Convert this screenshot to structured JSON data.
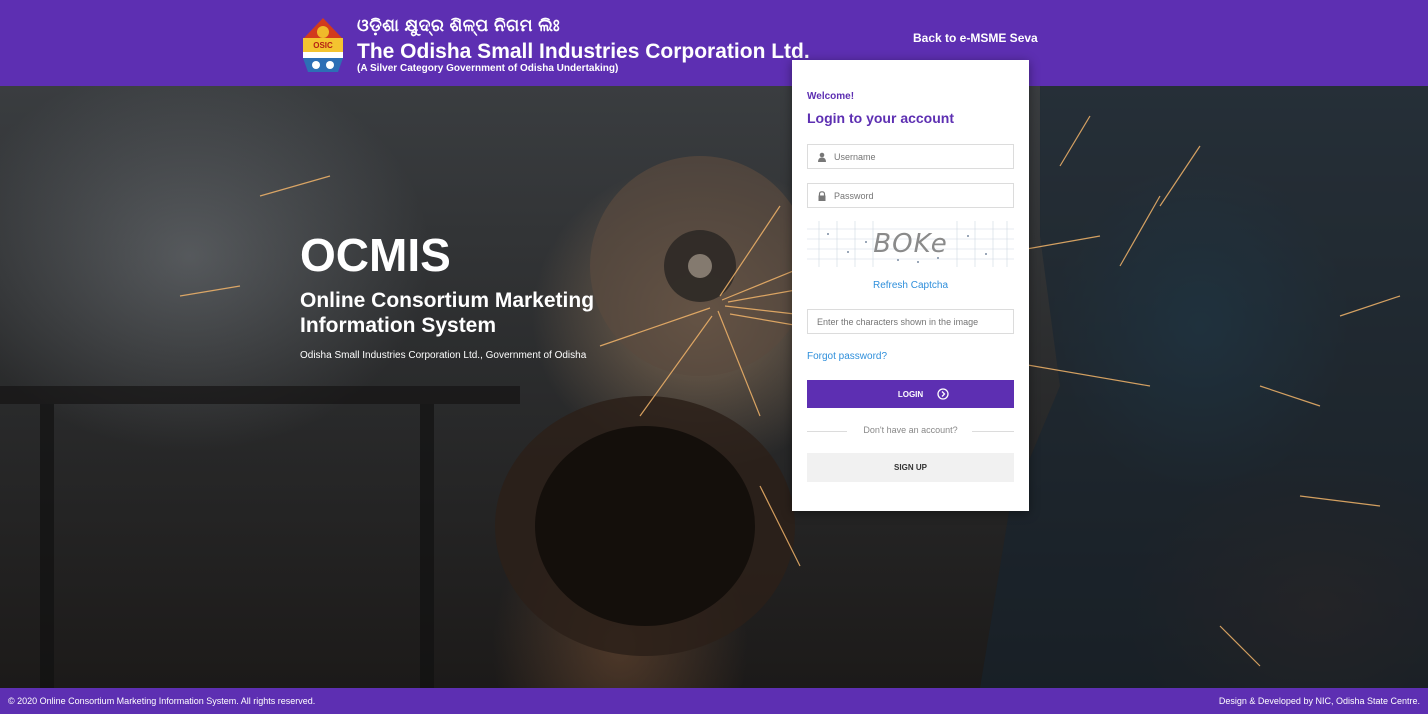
{
  "header": {
    "odia_title": "ଓଡ଼ିଶା କ୍ଷୁଦ୍ର ଶିଳ୍ପ ନିଗମ ଲିଃ",
    "title": "The Odisha Small Industries Corporation Ltd.",
    "subtitle": "(A Silver Category Government of Odisha Undertaking)",
    "back_link": "Back to e-MSME Seva",
    "logo_icon": "osic-logo-icon"
  },
  "hero": {
    "title": "OCMIS",
    "subtitle": "Online Consortium Marketing Information System",
    "org": "Odisha Small Industries Corporation Ltd., Government of Odisha"
  },
  "login": {
    "welcome": "Welcome!",
    "heading": "Login to your account",
    "username_placeholder": "Username",
    "password_placeholder": "Password",
    "captcha_text": "BOKe",
    "refresh_label": "Refresh Captcha",
    "captcha_placeholder": "Enter the characters shown in the image",
    "forgot_label": "Forgot password?",
    "login_label": "LOGIN",
    "no_account_label": "Don't have an account?",
    "signup_label": "SIGN UP"
  },
  "footer": {
    "copyright": "© 2020 Online Consortium Marketing Information System. All rights reserved.",
    "credit": "Design & Developed by NIC, Odisha State Centre."
  },
  "colors": {
    "brand": "#5d2fb2",
    "link": "#2f8fdb"
  }
}
